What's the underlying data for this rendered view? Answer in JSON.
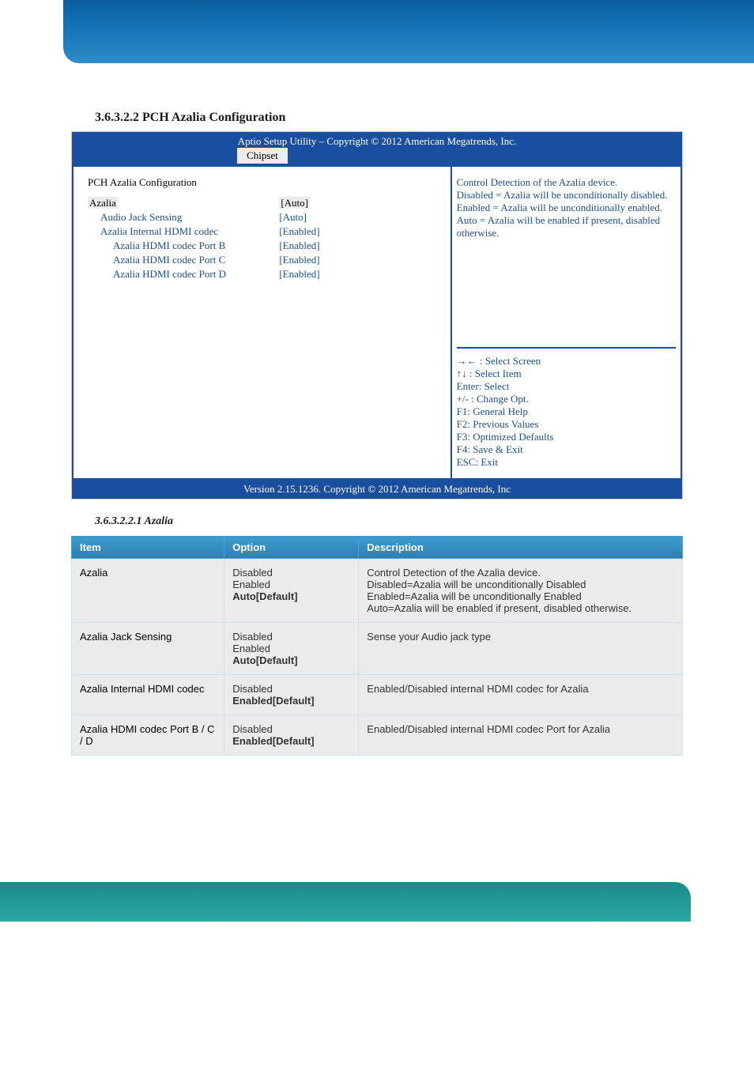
{
  "bios": {
    "section_heading": "3.6.3.2.2 PCH Azalia Configuration",
    "header_title": "Aptio Setup Utility  –  Copyright © 2012 American Megatrends, Inc.",
    "tab_label": "Chipset",
    "panel_title": "PCH Azalia Configuration",
    "items": [
      {
        "label": "Azalia",
        "value": "[Auto]",
        "indent": 0,
        "highlighted": true
      },
      {
        "label": "Audio Jack Sensing",
        "value": "[Auto]",
        "indent": 1,
        "highlighted": false
      },
      {
        "label": "Azalia Internal HDMI codec",
        "value": "[Enabled]",
        "indent": 1,
        "highlighted": false
      },
      {
        "label": "Azalia HDMI codec Port B",
        "value": "[Enabled]",
        "indent": 2,
        "highlighted": false
      },
      {
        "label": "Azalia HDMI codec Port C",
        "value": "[Enabled]",
        "indent": 2,
        "highlighted": false
      },
      {
        "label": "Azalia HDMI codec Port D",
        "value": "[Enabled]",
        "indent": 2,
        "highlighted": false
      }
    ],
    "help_text": "Control Detection of the Azalia device.\nDisabled = Azalia will be unconditionally disabled.\nEnabled = Azalia will be unconditionally enabled.\nAuto = Azalia will be enabled if present, disabled otherwise.",
    "nav_hints": [
      "→← : Select Screen",
      "↑↓ : Select Item",
      "Enter: Select",
      "+/- : Change Opt.",
      "F1: General Help",
      "F2: Previous Values",
      "F3: Optimized Defaults",
      "F4: Save & Exit",
      "ESC: Exit"
    ],
    "footer_text": "Version 2.15.1236. Copyright © 2012 American Megatrends, Inc"
  },
  "table": {
    "heading": "3.6.3.2.2.1 Azalia",
    "headers": [
      "Item",
      "Option",
      "Description"
    ],
    "rows": [
      {
        "item": "Azalia",
        "option": "Disabled\nEnabled\nAuto[Default]",
        "option_bold": [
          false,
          false,
          true
        ],
        "description": "Control Detection of the Azalia device.\nDisabled=Azalia will be unconditionally Disabled\nEnabled=Azalia will be unconditionally Enabled\nAuto=Azalia will be enabled if present, disabled otherwise."
      },
      {
        "item": "Azalia Jack Sensing",
        "option": "Disabled\nEnabled\nAuto[Default]",
        "option_bold": [
          false,
          false,
          true
        ],
        "description": "Sense your Audio jack type"
      },
      {
        "item": "Azalia Internal HDMI codec",
        "option": "Disabled\nEnabled[Default]",
        "option_bold": [
          false,
          true
        ],
        "description": "Enabled/Disabled internal HDMI codec for Azalia"
      },
      {
        "item": "Azalia HDMI codec Port B / C / D",
        "option": "Disabled\nEnabled[Default]",
        "option_bold": [
          false,
          true
        ],
        "description": "Enabled/Disabled internal HDMI codec Port for Azalia"
      }
    ]
  }
}
